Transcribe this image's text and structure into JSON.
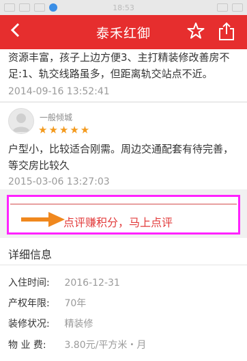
{
  "status_bar": {
    "time": "18:53"
  },
  "header": {
    "title": "泰禾红御",
    "back_icon": "chevron-left-icon",
    "star_icon": "star-icon",
    "share_icon": "share-icon"
  },
  "reviews": [
    {
      "text": "资源丰富，孩子上边方便3、主打精装修改善房不足:1、轨交线路虽多，但距离轨交站点不近。",
      "time": "2014-09-16 13:52:41"
    },
    {
      "user": "一般倾城",
      "stars": "★★★★★",
      "text": "户型小，比较适合刚需。周边交通配套有待完善，等交房比较久",
      "time": "2015-03-06 13:27:03"
    }
  ],
  "cta": {
    "label": "点评赚积分，马上点评",
    "highlight_color": "#ff22ff",
    "arrow_color": "#f0881e"
  },
  "details": {
    "title": "详细信息",
    "rows": [
      {
        "label": "入住时间:",
        "value": "2016-12-31"
      },
      {
        "label": "产权年限:",
        "value": "70年"
      },
      {
        "label": "装修状况:",
        "value": "精装修"
      },
      {
        "label": "物 业 费:",
        "value": "3.80元/平方米・月"
      }
    ]
  },
  "colors": {
    "brand": "#e62e2e",
    "star": "#f39a1e"
  }
}
